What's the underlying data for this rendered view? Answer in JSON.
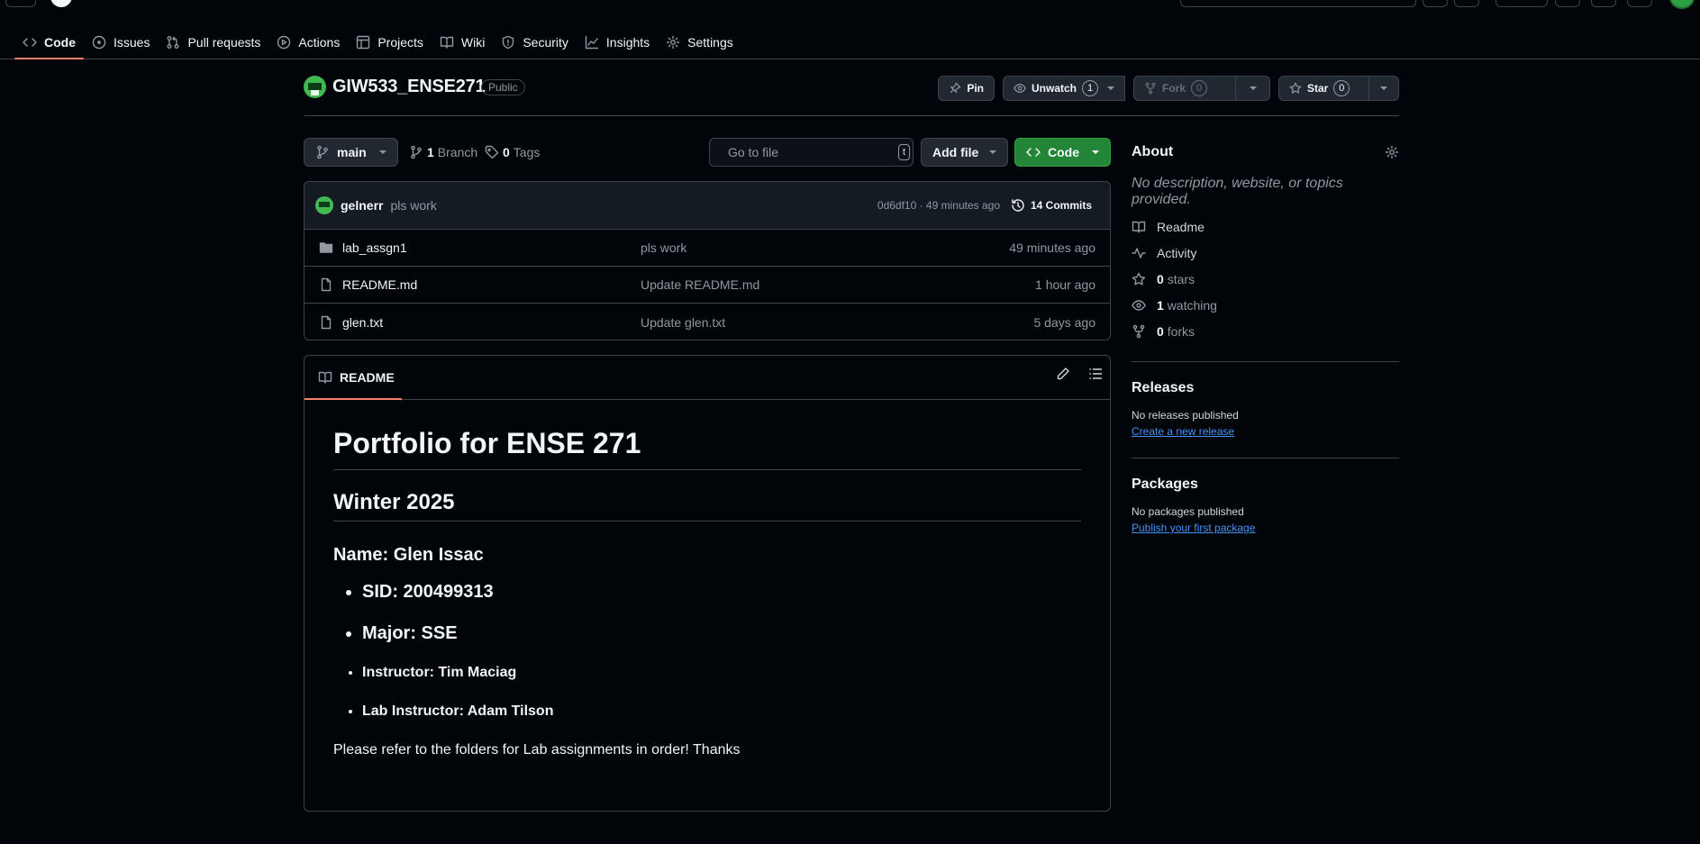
{
  "nav": {
    "tabs": [
      {
        "label": "Code",
        "icon": "code-icon",
        "active": true
      },
      {
        "label": "Issues",
        "icon": "issue-icon"
      },
      {
        "label": "Pull requests",
        "icon": "pull-request-icon"
      },
      {
        "label": "Actions",
        "icon": "play-icon"
      },
      {
        "label": "Projects",
        "icon": "table-icon"
      },
      {
        "label": "Wiki",
        "icon": "book-icon"
      },
      {
        "label": "Security",
        "icon": "shield-icon"
      },
      {
        "label": "Insights",
        "icon": "graph-icon"
      },
      {
        "label": "Settings",
        "icon": "gear-icon"
      }
    ]
  },
  "repo": {
    "name": "GIW533_ENSE271",
    "visibility": "Public",
    "pin_label": "Pin",
    "unwatch_label": "Unwatch",
    "watch_count": "1",
    "fork_label": "Fork",
    "fork_count": "0",
    "star_label": "Star",
    "star_count": "0"
  },
  "toolbar": {
    "branch": "main",
    "branch_count": "1",
    "branch_label": "Branch",
    "tag_count": "0",
    "tag_label": "Tags",
    "goto_placeholder": "Go to file",
    "goto_key": "t",
    "add_file_label": "Add file",
    "code_label": "Code"
  },
  "latest_commit": {
    "author": "gelnerr",
    "message": "pls work",
    "meta": "0d6df10 · 49 minutes ago",
    "commits_label": "14 Commits"
  },
  "files": [
    {
      "name": "lab_assgn1",
      "type": "folder",
      "commit": "pls work",
      "age": "49 minutes ago"
    },
    {
      "name": "README.md",
      "type": "file",
      "commit": "Update README.md",
      "age": "1 hour ago"
    },
    {
      "name": "glen.txt",
      "type": "file",
      "commit": "Update glen.txt",
      "age": "5 days ago"
    }
  ],
  "readme": {
    "tab_label": "README",
    "h1": "Portfolio for ENSE 271",
    "h2": "Winter 2025",
    "h3": "Name: Glen Issac",
    "items": [
      "SID: 200499313",
      "Major: SSE",
      "Instructor: Tim Maciag",
      "Lab Instructor: Adam Tilson"
    ],
    "paragraph": "Please refer to the folders for Lab assignments in order! Thanks"
  },
  "about": {
    "title": "About",
    "description": "No description, website, or topics provided.",
    "readme_label": "Readme",
    "activity_label": "Activity",
    "stars_count": "0",
    "stars_label": "stars",
    "watching_count": "1",
    "watching_label": "watching",
    "forks_count": "0",
    "forks_label": "forks"
  },
  "releases": {
    "title": "Releases",
    "empty": "No releases published",
    "link": "Create a new release"
  },
  "packages": {
    "title": "Packages",
    "empty": "No packages published",
    "link": "Publish your first package"
  },
  "colors": {
    "background": "#010409",
    "border": "#3d444d",
    "accent_tab": "#f78166",
    "code_button": "#238636",
    "link": "#4493f8"
  }
}
